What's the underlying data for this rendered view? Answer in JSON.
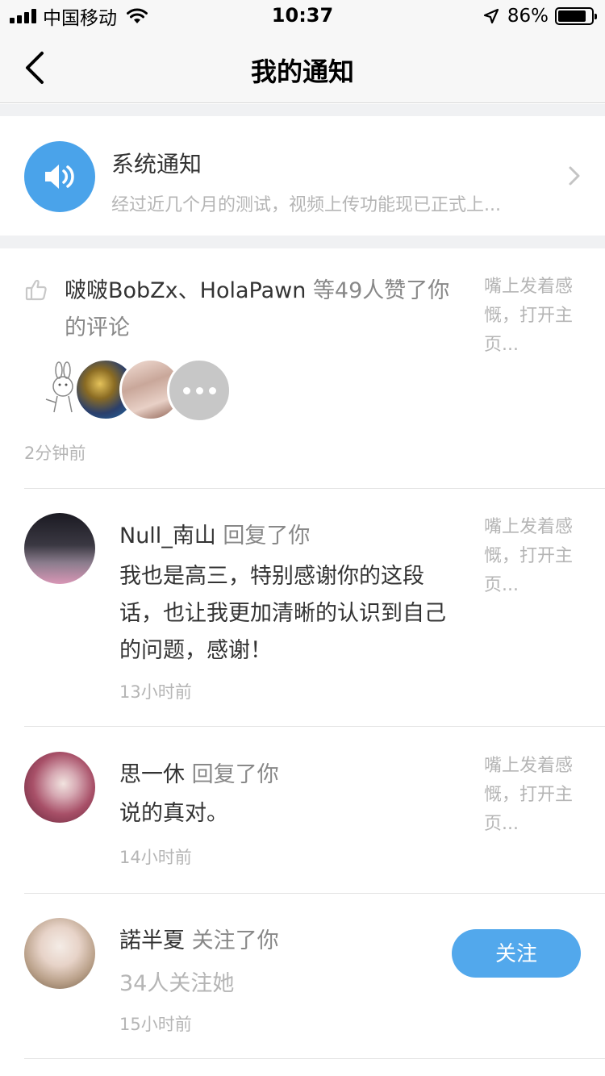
{
  "status_bar": {
    "carrier": "中国移动",
    "time": "10:37",
    "battery_percent": "86%",
    "battery_level": 0.86,
    "icons": [
      "signal-icon",
      "wifi-icon",
      "location-arrow-icon",
      "battery-icon"
    ]
  },
  "nav": {
    "title": "我的通知",
    "back_icon": "chevron-left-icon"
  },
  "system_notice": {
    "title": "系统通知",
    "preview": "经过近几个月的测试，视频上传功能现已正式上...",
    "icon": "speaker-icon",
    "accent_color": "#4aa3ea"
  },
  "like_notice": {
    "users": "啵啵BobZx、HolaPawn",
    "action": "等49人赞了你的评论",
    "context": "嘴上发着感慨，打开主页...",
    "time": "2分钟前",
    "icon": "thumbs-up-icon"
  },
  "replies": [
    {
      "name": "Null_南山",
      "action": "回复了你",
      "content": "我也是高三，特别感谢你的这段话，也让我更加清晰的认识到自己的问题，感谢！",
      "context": "嘴上发着感慨，打开主页...",
      "time": "13小时前"
    },
    {
      "name": "思一休",
      "action": "回复了你",
      "content": "说的真对。",
      "context": "嘴上发着感慨，打开主页...",
      "time": "14小时前"
    }
  ],
  "follow_notice": {
    "name": "諾半夏",
    "action": "关注了你",
    "followers": "34人关注她",
    "time": "15小时前",
    "button_label": "关注",
    "button_color": "#52a8ec"
  }
}
